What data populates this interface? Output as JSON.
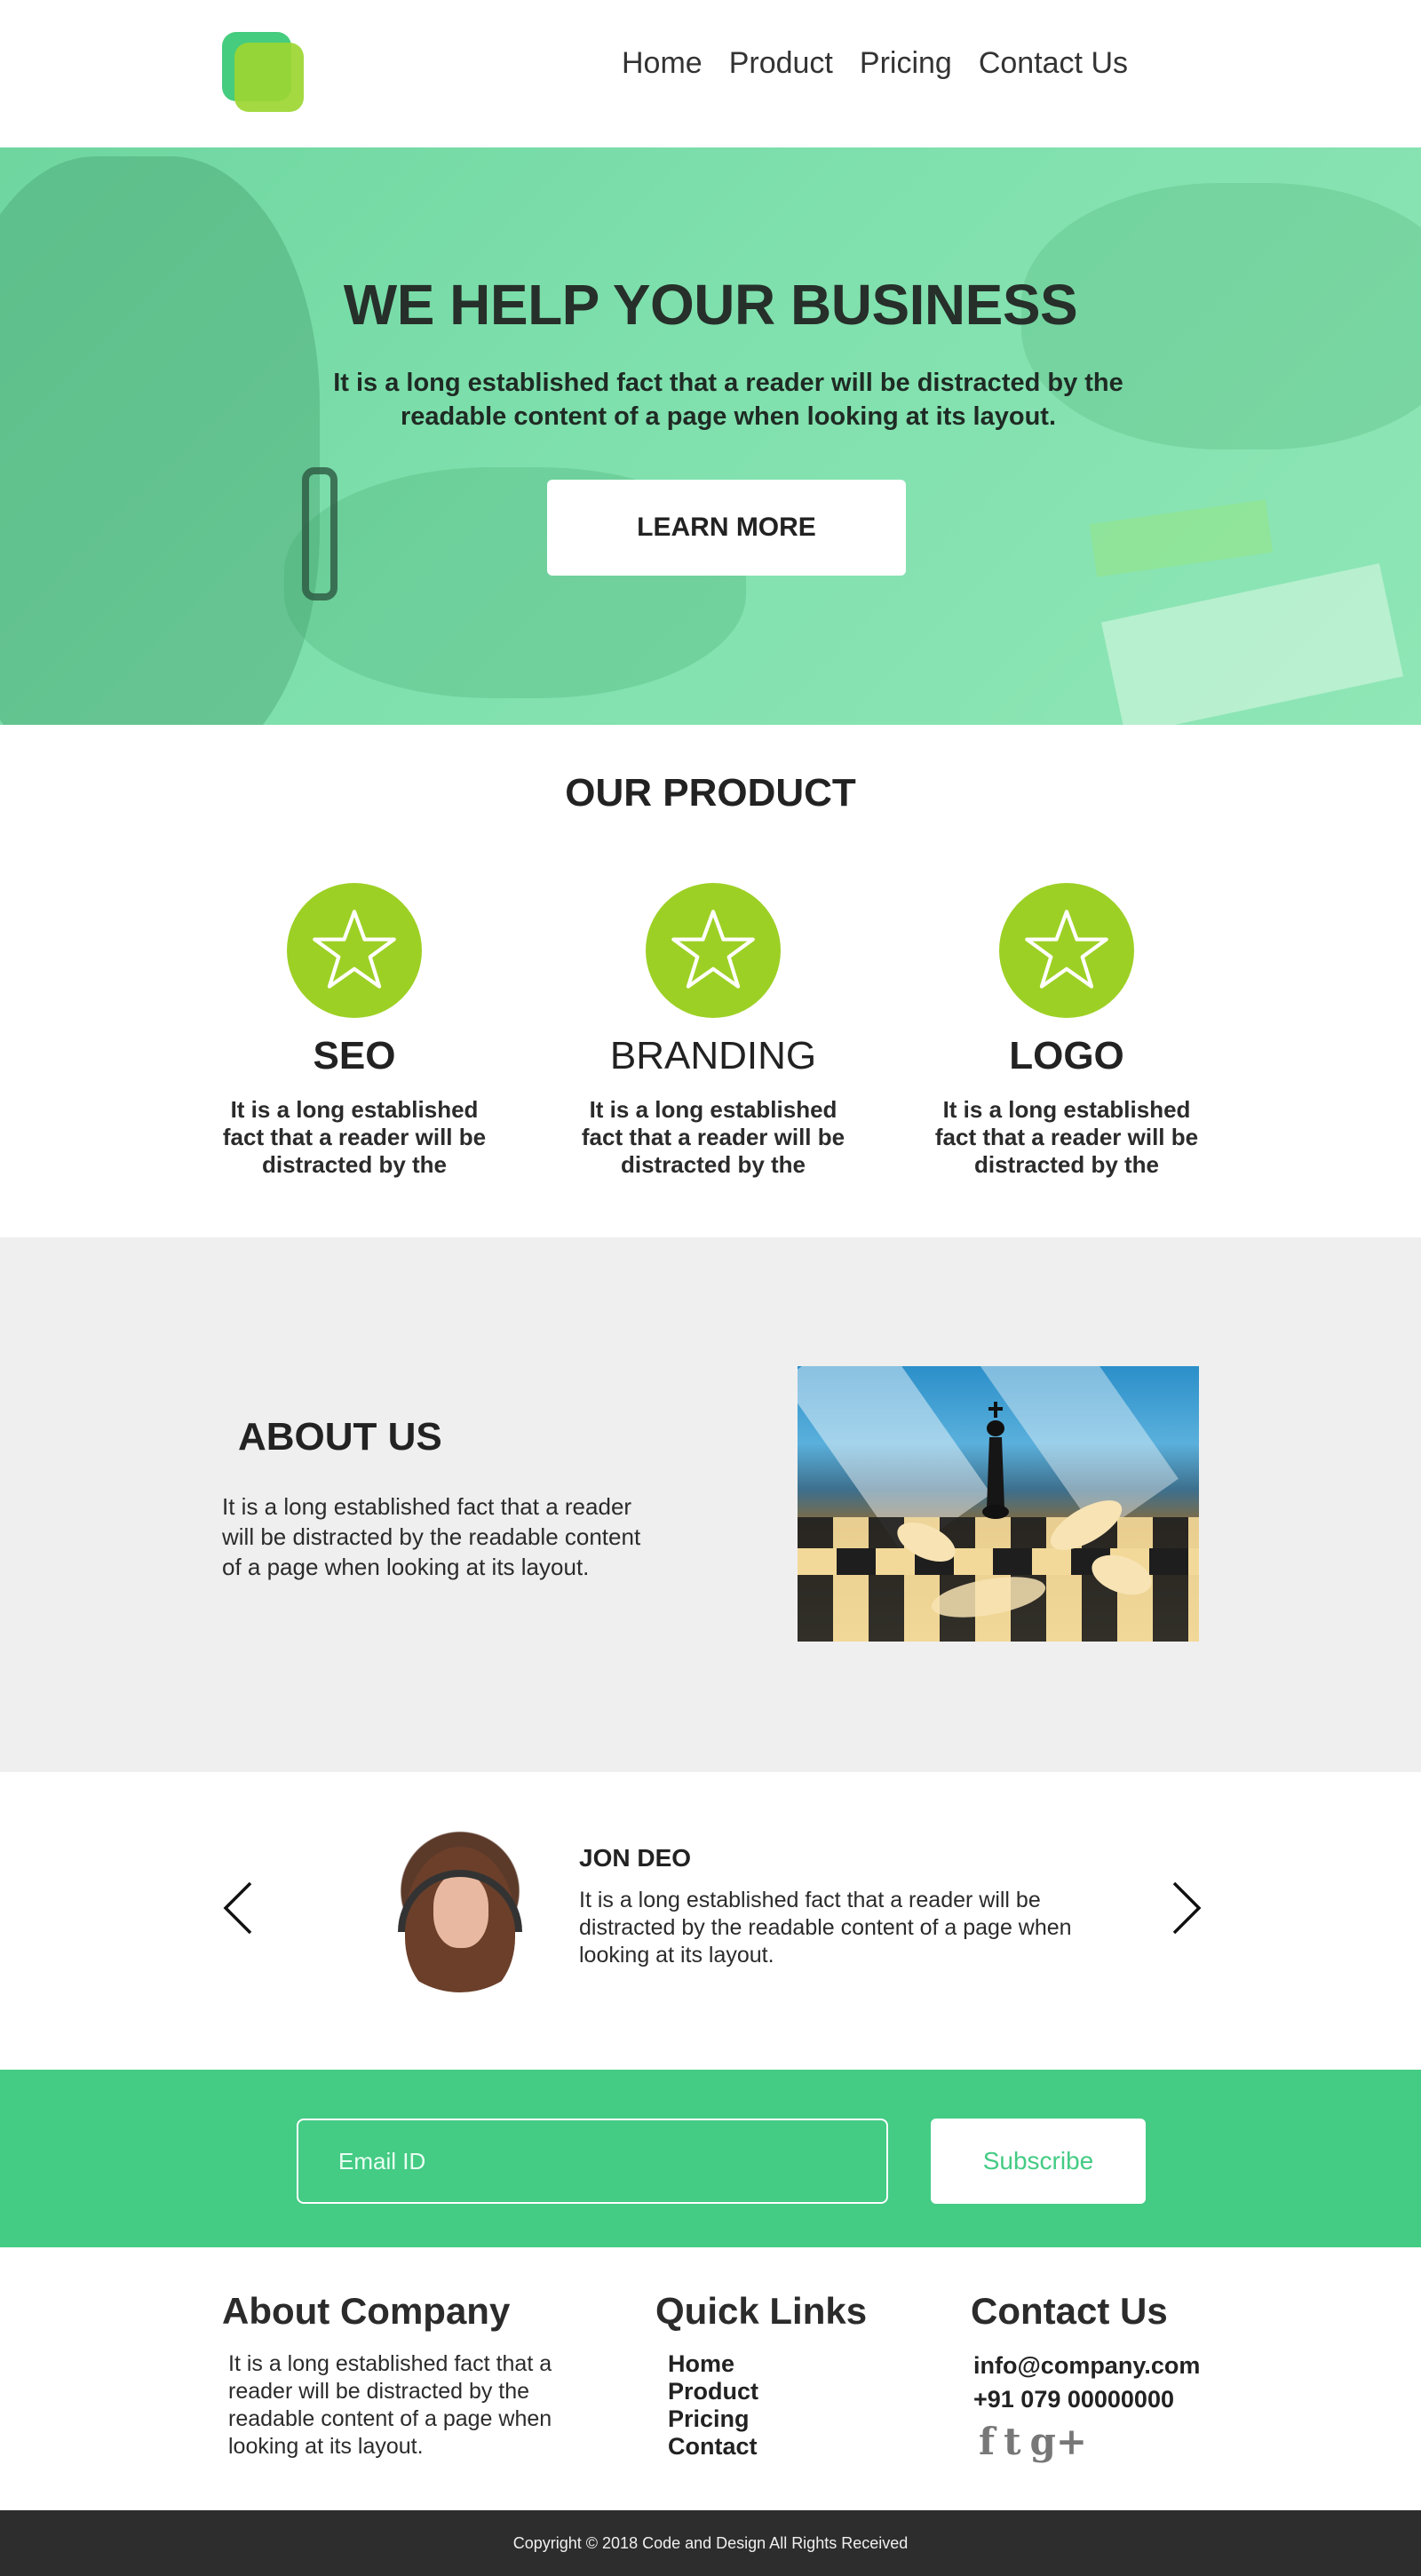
{
  "header": {
    "nav": [
      "Home",
      "Product",
      "Pricing",
      "Contact Us"
    ]
  },
  "hero": {
    "title": "WE HELP YOUR BUSINESS",
    "subtitle": "It is a long established fact that a reader will be distracted by the readable content of a page when looking at its layout.",
    "button_label": "LEARN MORE"
  },
  "product": {
    "title": "OUR PRODUCT",
    "items": [
      {
        "name": "SEO",
        "desc": "It is a long established fact that a reader will be distracted by the",
        "icon": "star-icon"
      },
      {
        "name": "BRANDING",
        "desc": "It is a long established fact that a reader will be distracted by the",
        "icon": "star-icon"
      },
      {
        "name": "LOGO",
        "desc": "It is a long established fact that a reader will be distracted by the",
        "icon": "star-icon"
      }
    ]
  },
  "about": {
    "title": "ABOUT US",
    "text": "It is a long established fact that a reader will be distracted by the readable content of a page when looking at its layout."
  },
  "testimonial": {
    "name": "JON DEO",
    "text": "It is a long established fact that a reader will be distracted by the readable content of a page when looking at its layout."
  },
  "subscribe": {
    "email_placeholder": "Email ID",
    "button_label": "Subscribe"
  },
  "footer": {
    "about_heading": "About Company",
    "about_text": "It is a long established fact that a reader will be distracted by the readable content of a page when looking at its layout.",
    "links_heading": "Quick Links",
    "links": [
      "Home",
      "Product",
      "Pricing",
      "Contact"
    ],
    "contact_heading": "Contact Us",
    "email": "info@company.com",
    "phone": "+91 079 00000000",
    "social": [
      {
        "icon": "facebook-icon",
        "glyph": "f"
      },
      {
        "icon": "twitter-icon",
        "glyph": "t"
      },
      {
        "icon": "google-plus-icon",
        "glyph": "g+"
      }
    ]
  },
  "copyright": "Copyright ©  2018 Code and Design All Rights Received",
  "colors": {
    "accent_green": "#44cb84",
    "lime": "#9dd025",
    "dark": "#2d2d2d",
    "about_bg": "#efefef"
  }
}
